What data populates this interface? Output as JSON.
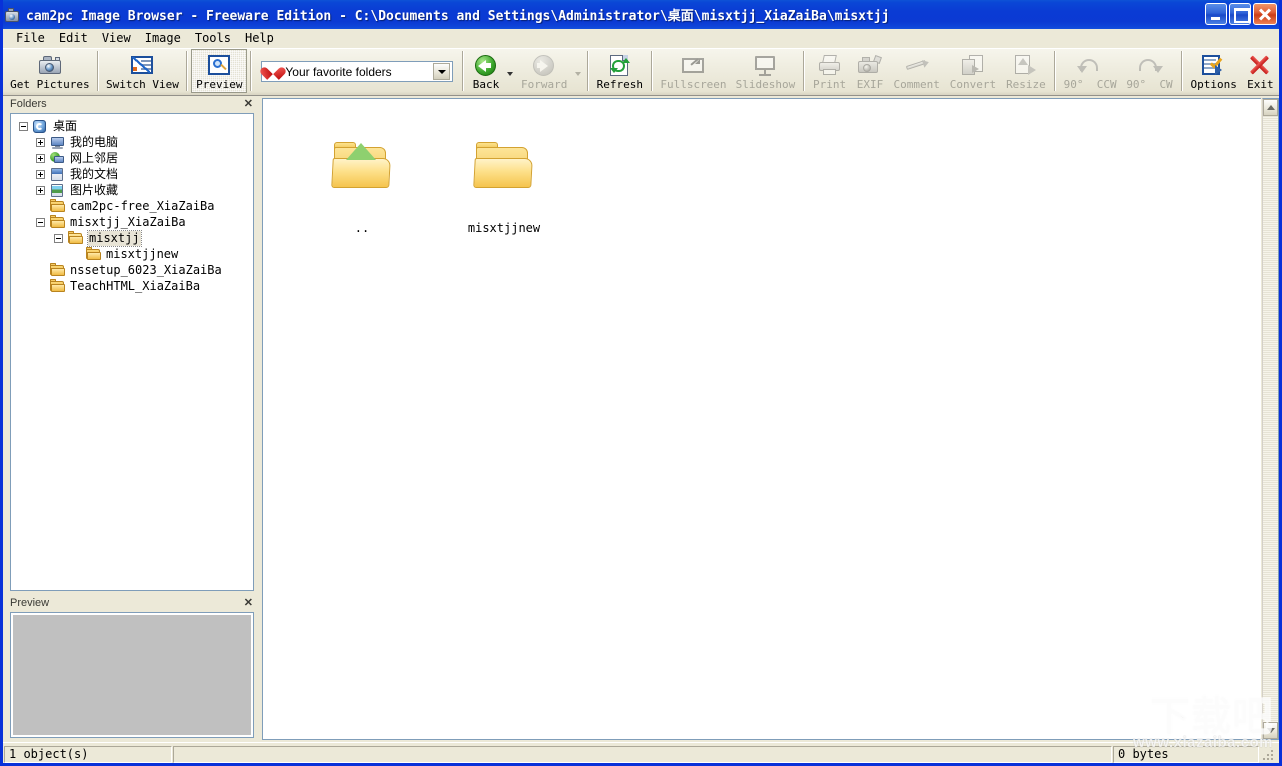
{
  "window": {
    "title": "cam2pc Image Browser - Freeware Edition - C:\\Documents and Settings\\Administrator\\桌面\\misxtjj_XiaZaiBa\\misxtjj",
    "app_icon": "camera-icon",
    "controls": {
      "minimize": "minimize-button",
      "maximize": "maximize-button",
      "close": "close-button"
    },
    "accent_titlebar": "#0a3bd4",
    "chrome_bg": "#ece9d8"
  },
  "menu": {
    "items": [
      {
        "label": "File"
      },
      {
        "label": "Edit"
      },
      {
        "label": "View"
      },
      {
        "label": "Image"
      },
      {
        "label": "Tools"
      },
      {
        "label": "Help"
      }
    ]
  },
  "toolbar": {
    "buttons": [
      {
        "label": "Get Pictures",
        "icon": "camera-icon",
        "enabled": true,
        "pressed": false
      },
      {
        "label": "Switch View",
        "icon": "switch-view-icon",
        "enabled": true,
        "pressed": false
      },
      {
        "label": "Preview",
        "icon": "magnifier-icon",
        "enabled": true,
        "pressed": true
      },
      {
        "label": "Back",
        "icon": "back-arrow-icon",
        "enabled": true,
        "pressed": false
      },
      {
        "label": "Forward",
        "icon": "forward-arrow-icon",
        "enabled": false,
        "pressed": false
      },
      {
        "label": "Refresh",
        "icon": "refresh-icon",
        "enabled": true,
        "pressed": false
      },
      {
        "label": "Fullscreen",
        "icon": "fullscreen-icon",
        "enabled": false,
        "pressed": false
      },
      {
        "label": "Slideshow",
        "icon": "slideshow-icon",
        "enabled": false,
        "pressed": false
      },
      {
        "label": "Print",
        "icon": "printer-icon",
        "enabled": false,
        "pressed": false
      },
      {
        "label": "EXIF",
        "icon": "exif-camera-icon",
        "enabled": false,
        "pressed": false
      },
      {
        "label": "Comment",
        "icon": "pencil-icon",
        "enabled": false,
        "pressed": false
      },
      {
        "label": "Convert",
        "icon": "convert-icon",
        "enabled": false,
        "pressed": false
      },
      {
        "label": "Resize",
        "icon": "resize-icon",
        "enabled": false,
        "pressed": false
      },
      {
        "label": "90°",
        "icon": "rotate-ccw-icon",
        "enabled": false,
        "pressed": false
      },
      {
        "label": "CCW",
        "icon": "rotate-ccw-label",
        "enabled": false,
        "pressed": false
      },
      {
        "label": "90°",
        "icon": "rotate-cw-icon",
        "enabled": false,
        "pressed": false
      },
      {
        "label": "CW",
        "icon": "rotate-cw-label",
        "enabled": false,
        "pressed": false
      },
      {
        "label": "Options",
        "icon": "options-icon",
        "enabled": true,
        "pressed": false
      },
      {
        "label": "Exit",
        "icon": "exit-x-icon",
        "enabled": true,
        "pressed": false
      }
    ],
    "labels": {
      "get_pictures": "Get Pictures",
      "switch_view": "Switch View",
      "preview": "Preview",
      "back": "Back",
      "forward": "Forward",
      "refresh": "Refresh",
      "fullscreen": "Fullscreen",
      "slideshow": "Slideshow",
      "print": "Print",
      "exif": "EXIF",
      "comment": "Comment",
      "convert": "Convert",
      "resize": "Resize",
      "rot90_a": "90°",
      "ccw": "CCW",
      "rot90_b": "90°",
      "cw": "CW",
      "options": "Options",
      "exit": "Exit"
    },
    "favorites": {
      "value": "Your favorite folders",
      "icon": "heart-icon"
    }
  },
  "folders_panel": {
    "title": "Folders",
    "close_glyph": "✕",
    "tree": [
      {
        "label": "桌面",
        "depth": 0,
        "expander": "minus",
        "icon": "desktop-icon",
        "selected": false,
        "cjk": true
      },
      {
        "label": "我的电脑",
        "depth": 1,
        "expander": "plus",
        "icon": "my-computer-icon",
        "selected": false,
        "cjk": true
      },
      {
        "label": "网上邻居",
        "depth": 1,
        "expander": "plus",
        "icon": "network-places-icon",
        "selected": false,
        "cjk": true
      },
      {
        "label": "我的文档",
        "depth": 1,
        "expander": "plus",
        "icon": "my-documents-icon",
        "selected": false,
        "cjk": true
      },
      {
        "label": "图片收藏",
        "depth": 1,
        "expander": "plus",
        "icon": "my-pictures-icon",
        "selected": false,
        "cjk": true
      },
      {
        "label": "cam2pc-free_XiaZaiBa",
        "depth": 1,
        "expander": "none",
        "icon": "folder-icon",
        "selected": false,
        "cjk": false
      },
      {
        "label": "misxtjj_XiaZaiBa",
        "depth": 1,
        "expander": "minus",
        "icon": "folder-icon",
        "selected": false,
        "cjk": false
      },
      {
        "label": "misxtjj",
        "depth": 2,
        "expander": "minus",
        "icon": "folder-open-icon",
        "selected": true,
        "cjk": false
      },
      {
        "label": "misxtjjnew",
        "depth": 3,
        "expander": "none",
        "icon": "folder-icon",
        "selected": false,
        "cjk": false
      },
      {
        "label": "nssetup_6023_XiaZaiBa",
        "depth": 1,
        "expander": "none",
        "icon": "folder-icon",
        "selected": false,
        "cjk": false
      },
      {
        "label": "TeachHTML_XiaZaiBa",
        "depth": 1,
        "expander": "none",
        "icon": "folder-icon",
        "selected": false,
        "cjk": false
      }
    ]
  },
  "preview_panel": {
    "title": "Preview",
    "close_glyph": "✕",
    "content_color": "#c0c0c0"
  },
  "thumbnails": {
    "items": [
      {
        "label": "..",
        "icon": "folder-up-icon"
      },
      {
        "label": "misxtjjnew",
        "icon": "folder-icon"
      }
    ]
  },
  "scrollbar": {
    "up_arrow": "scroll-up-icon",
    "down_arrow": "scroll-down-icon"
  },
  "status_bar": {
    "left": "1 object(s)",
    "middle": "",
    "right": "0 bytes"
  },
  "watermark": {
    "big": "下载吧",
    "small": "www.xiazaiba.com"
  }
}
